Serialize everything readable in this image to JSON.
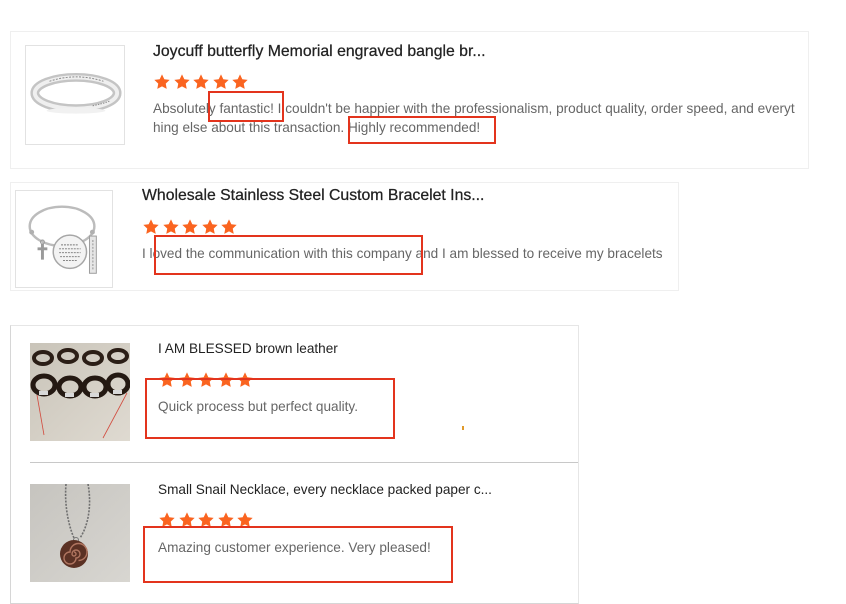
{
  "reviews": [
    {
      "title": "Joycuff butterfly Memorial engraved bangle br...",
      "rating": 5,
      "text_lines": [
        "Absolutely fantastic! I couldn't be happier with the professionalism, product quality, order speed, and everyt",
        "hing else about this transaction. Highly recommended!"
      ]
    },
    {
      "title": "Wholesale Stainless Steel Custom Bracelet Ins...",
      "rating": 5,
      "text_lines": [
        "I loved the communication with this company and I am blessed to receive my bracelets"
      ]
    },
    {
      "title": "I AM BLESSED brown leather",
      "rating": 5,
      "text_lines": [
        "Quick process but perfect quality."
      ]
    },
    {
      "title": "Small Snail Necklace, every necklace packed paper c...",
      "rating": 5,
      "text_lines": [
        "Amazing customer experience. Very pleased!"
      ]
    }
  ],
  "icons": {
    "rating": "star-icon"
  },
  "colors": {
    "star": "#fa6420",
    "star_empty": "#dddddd",
    "highlight_box": "#e3341d",
    "title": "#222222",
    "text": "#666666"
  }
}
